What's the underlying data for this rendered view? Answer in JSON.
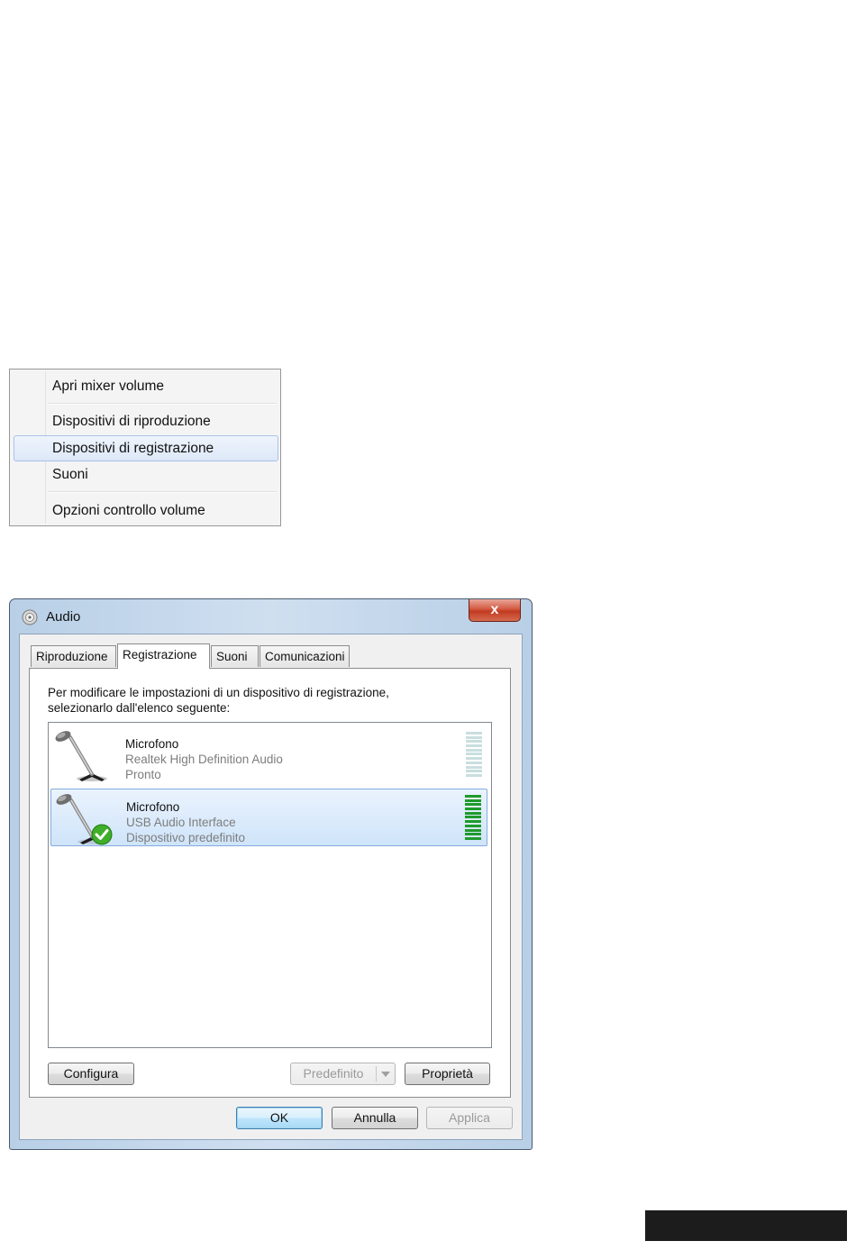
{
  "context_menu": {
    "items": [
      {
        "label": "Apri mixer volume"
      },
      {
        "label": "Dispositivi di riproduzione"
      },
      {
        "label": "Dispositivi di registrazione"
      },
      {
        "label": "Suoni"
      },
      {
        "label": "Opzioni controllo volume"
      }
    ],
    "highlighted_index": 2
  },
  "dialog": {
    "title": "Audio",
    "close_label": "x",
    "tabs": [
      {
        "label": "Riproduzione"
      },
      {
        "label": "Registrazione"
      },
      {
        "label": "Suoni"
      },
      {
        "label": "Comunicazioni"
      }
    ],
    "active_tab": 1,
    "instruction_line1": "Per modificare le impostazioni di un dispositivo di registrazione,",
    "instruction_line2": "selezionarlo dall'elenco seguente:",
    "devices": [
      {
        "name": "Microfono",
        "driver": "Realtek High Definition Audio",
        "status": "Pronto",
        "selected": false,
        "default": false,
        "level": 0
      },
      {
        "name": "Microfono",
        "driver": "USB Audio Interface",
        "status": "Dispositivo predefinito",
        "selected": true,
        "default": true,
        "level": 1.0
      }
    ],
    "buttons": {
      "configure": "Configura",
      "set_default": "Predefinito",
      "properties": "Proprietà",
      "ok": "OK",
      "cancel": "Annulla",
      "apply": "Applica"
    }
  },
  "colors": {
    "meter_off": "#c9dedf",
    "meter_on": "#1e9b2a",
    "selection_border": "#84acdd",
    "close_button": "#c23b22"
  }
}
